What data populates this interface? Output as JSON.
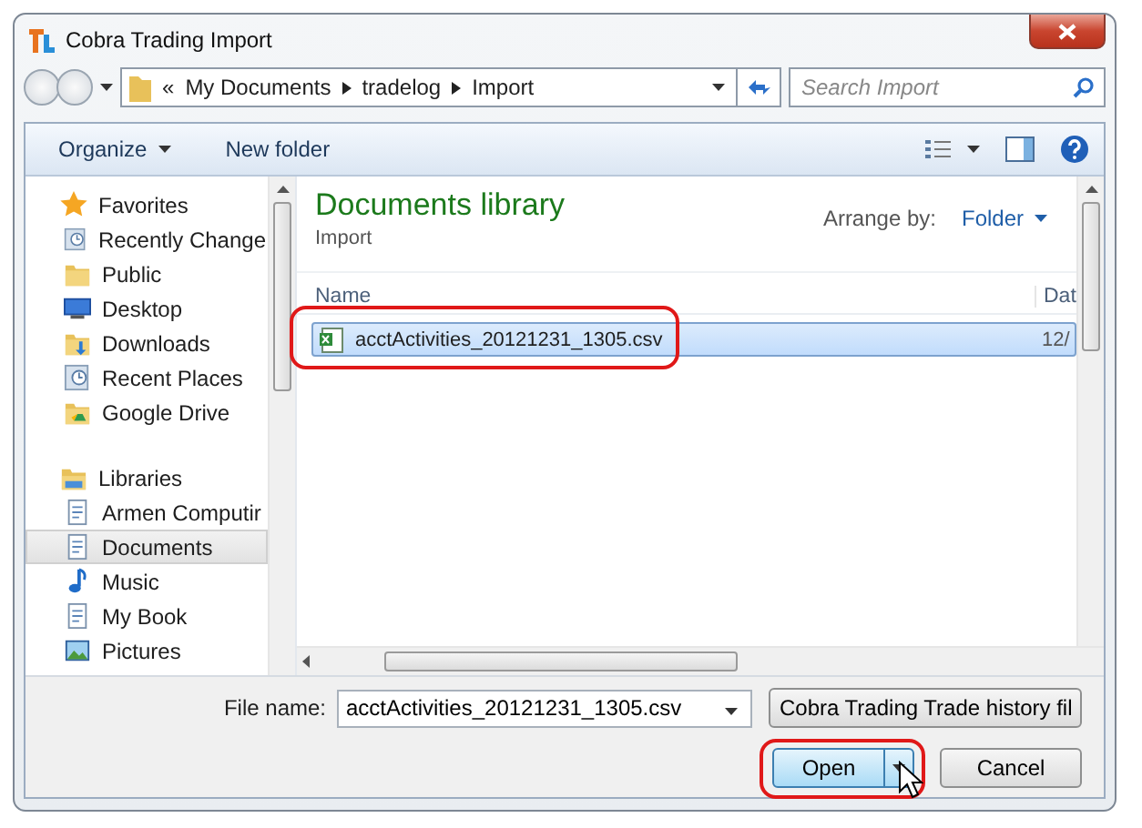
{
  "window": {
    "title": "Cobra Trading Import"
  },
  "address": {
    "overflow": "«",
    "path": [
      "My Documents",
      "tradelog",
      "Import"
    ]
  },
  "search": {
    "placeholder": "Search Import"
  },
  "toolbar": {
    "organize": "Organize",
    "new_folder": "New folder"
  },
  "sidebar": [
    {
      "label": "Favorites",
      "kind": "star",
      "selected": false,
      "children": [
        {
          "label": "Recently Change",
          "kind": "recent",
          "selected": false
        },
        {
          "label": "Public",
          "kind": "folder",
          "selected": false
        },
        {
          "label": "Desktop",
          "kind": "desktop",
          "selected": false
        },
        {
          "label": "Downloads",
          "kind": "downloads",
          "selected": false
        },
        {
          "label": "Recent Places",
          "kind": "recent",
          "selected": false
        },
        {
          "label": "Google Drive",
          "kind": "drive",
          "selected": false
        }
      ]
    },
    {
      "label": "Libraries",
      "kind": "libraries",
      "selected": false,
      "children": [
        {
          "label": "Armen Computir",
          "kind": "library",
          "selected": false
        },
        {
          "label": "Documents",
          "kind": "document",
          "selected": true
        },
        {
          "label": "Music",
          "kind": "music",
          "selected": false
        },
        {
          "label": "My Book",
          "kind": "library",
          "selected": false
        },
        {
          "label": "Pictures",
          "kind": "pictures",
          "selected": false
        }
      ]
    }
  ],
  "library": {
    "title": "Documents library",
    "subtitle": "Import",
    "arrange_label": "Arrange by:",
    "arrange_value": "Folder"
  },
  "columns": [
    "Name",
    "Dat"
  ],
  "files": [
    {
      "name": "acctActivities_20121231_1305.csv",
      "column_2": "12/",
      "selected": true,
      "highlighted": true
    }
  ],
  "file_name": {
    "label": "File name:",
    "value": "acctActivities_20121231_1305.csv"
  },
  "file_type": {
    "value": "Cobra Trading Trade history fil"
  },
  "buttons": {
    "open": {
      "label": "Open",
      "highlighted": true
    },
    "cancel": {
      "label": "Cancel"
    }
  }
}
